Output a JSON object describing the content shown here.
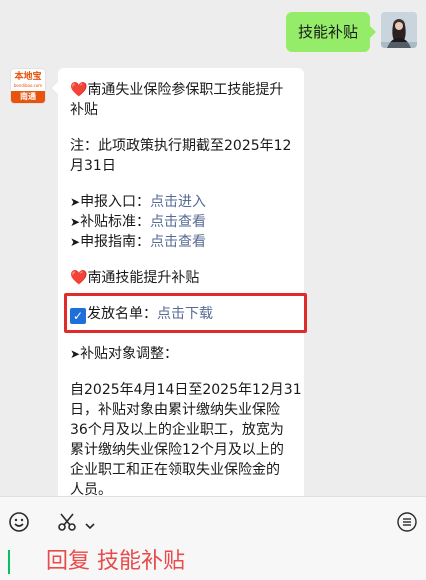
{
  "outgoing": {
    "text": "技能补贴"
  },
  "brand": {
    "name": "本地宝",
    "domain": "bendibao.com",
    "city": "南通"
  },
  "card": {
    "heart_icon": "❤️",
    "title_line1": "南通失业保险参保职工技能提升",
    "title_line2": "补贴",
    "notice_line1": "注：此项政策执行期截至2025年12",
    "notice_line2": "月31日",
    "items": [
      {
        "label": "申报入口：",
        "link": "点击进入"
      },
      {
        "label": "补贴标准：",
        "link": "点击查看"
      },
      {
        "label": "申报指南：",
        "link": "点击查看"
      }
    ],
    "section_title": "南通技能提升补贴",
    "list_label": "发放名单：",
    "list_link": "点击下载",
    "adjust_title": "补贴对象调整：",
    "paragraph_lines": [
      "自2025年4月14日至2025年12月31",
      "日，补贴对象由累计缴纳失业保险",
      "36个月及以上的企业职工，放宽为",
      "累计缴纳失业保险12个月及以上的",
      "企业职工和正在领取失业保险金的",
      "人员。"
    ]
  },
  "input": {
    "reply_text": "回复 技能补贴"
  },
  "colors": {
    "outgoing_bubble": "#95ec69",
    "link": "#576b95",
    "highlight": "#e02b2b",
    "reply": "#e84b4b"
  },
  "icons": [
    "emoji-icon",
    "scissors-icon",
    "chevron-down-icon",
    "keyboard-icon"
  ]
}
